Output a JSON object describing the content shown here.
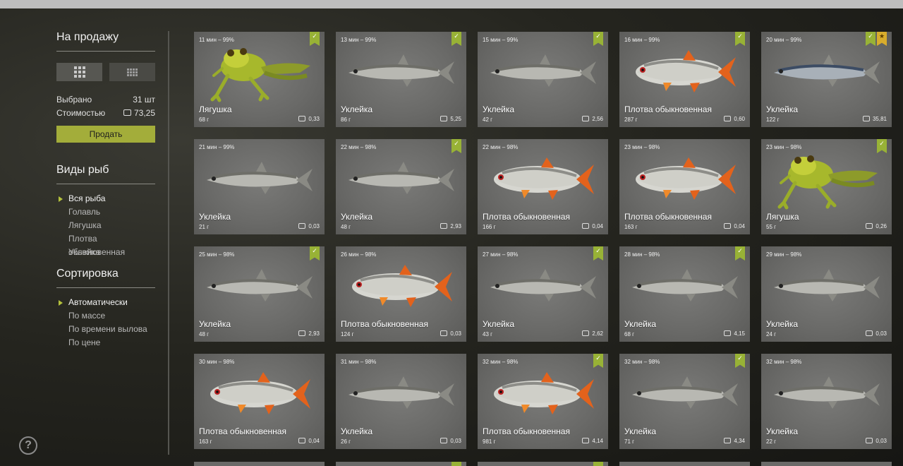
{
  "sidebar": {
    "for_sale_title": "На продажу",
    "selected_label": "Выбрано",
    "selected_value": "31 шт",
    "cost_label": "Стоимостью",
    "cost_value": "73,25",
    "sell_button": "Продать",
    "species_title": "Виды рыб",
    "species": [
      "Вся рыба",
      "Голавль",
      "Лягушка",
      "Плотва обыкновенная",
      "Уклейка"
    ],
    "species_selected": 0,
    "sort_title": "Сортировка",
    "sort_options": [
      "Автоматически",
      "По массе",
      "По времени вылова",
      "По цене"
    ],
    "sort_selected": 0,
    "help_label": "?"
  },
  "cards": [
    {
      "time": "11 мин – 99%",
      "name": "Лягушка",
      "weight": "68 г",
      "price": "0,33",
      "kind": "frog",
      "check": true,
      "star": false
    },
    {
      "time": "13 мин – 99%",
      "name": "Уклейка",
      "weight": "86 г",
      "price": "5,25",
      "kind": "bleak",
      "check": true,
      "star": false
    },
    {
      "time": "15 мин – 99%",
      "name": "Уклейка",
      "weight": "42 г",
      "price": "2,56",
      "kind": "bleak",
      "check": true,
      "star": false
    },
    {
      "time": "16 мин – 99%",
      "name": "Плотва обыкновенная",
      "weight": "287 г",
      "price": "0,60",
      "kind": "roach",
      "check": true,
      "star": false
    },
    {
      "time": "20 мин – 99%",
      "name": "Уклейка",
      "weight": "122 г",
      "price": "35,81",
      "kind": "bleak-blue",
      "check": true,
      "star": true
    },
    {
      "time": "21 мин – 99%",
      "name": "Уклейка",
      "weight": "21 г",
      "price": "0,03",
      "kind": "bleak",
      "check": false,
      "star": false
    },
    {
      "time": "22 мин – 98%",
      "name": "Уклейка",
      "weight": "48 г",
      "price": "2,93",
      "kind": "bleak",
      "check": true,
      "star": false
    },
    {
      "time": "22 мин – 98%",
      "name": "Плотва обыкновенная",
      "weight": "166 г",
      "price": "0,04",
      "kind": "roach",
      "check": false,
      "star": false
    },
    {
      "time": "23 мин – 98%",
      "name": "Плотва обыкновенная",
      "weight": "163 г",
      "price": "0,04",
      "kind": "roach",
      "check": false,
      "star": false
    },
    {
      "time": "23 мин – 98%",
      "name": "Лягушка",
      "weight": "55 г",
      "price": "0,26",
      "kind": "frog",
      "check": true,
      "star": false
    },
    {
      "time": "25 мин – 98%",
      "name": "Уклейка",
      "weight": "48 г",
      "price": "2,93",
      "kind": "bleak",
      "check": true,
      "star": false
    },
    {
      "time": "26 мин – 98%",
      "name": "Плотва обыкновенная",
      "weight": "124 г",
      "price": "0,03",
      "kind": "roach",
      "check": false,
      "star": false
    },
    {
      "time": "27 мин – 98%",
      "name": "Уклейка",
      "weight": "43 г",
      "price": "2,62",
      "kind": "bleak",
      "check": true,
      "star": false
    },
    {
      "time": "28 мин – 98%",
      "name": "Уклейка",
      "weight": "68 г",
      "price": "4,15",
      "kind": "bleak",
      "check": true,
      "star": false
    },
    {
      "time": "29 мин – 98%",
      "name": "Уклейка",
      "weight": "24 г",
      "price": "0,03",
      "kind": "bleak",
      "check": false,
      "star": false
    },
    {
      "time": "30 мин – 98%",
      "name": "Плотва обыкновенная",
      "weight": "163 г",
      "price": "0,04",
      "kind": "roach",
      "check": false,
      "star": false
    },
    {
      "time": "31 мин – 98%",
      "name": "Уклейка",
      "weight": "26 г",
      "price": "0,03",
      "kind": "bleak",
      "check": false,
      "star": false
    },
    {
      "time": "32 мин – 98%",
      "name": "Плотва обыкновенная",
      "weight": "981 г",
      "price": "4,14",
      "kind": "roach",
      "check": true,
      "star": false
    },
    {
      "time": "32 мин – 98%",
      "name": "Уклейка",
      "weight": "71 г",
      "price": "4,34",
      "kind": "bleak",
      "check": true,
      "star": false
    },
    {
      "time": "32 мин – 98%",
      "name": "Уклейка",
      "weight": "22 г",
      "price": "0,03",
      "kind": "bleak",
      "check": false,
      "star": false
    }
  ],
  "partial_row_checks": [
    false,
    true,
    true,
    false,
    false
  ],
  "colors": {
    "accent": "#a3ad3a",
    "check": "#98b236",
    "star": "#d8ac2c"
  }
}
